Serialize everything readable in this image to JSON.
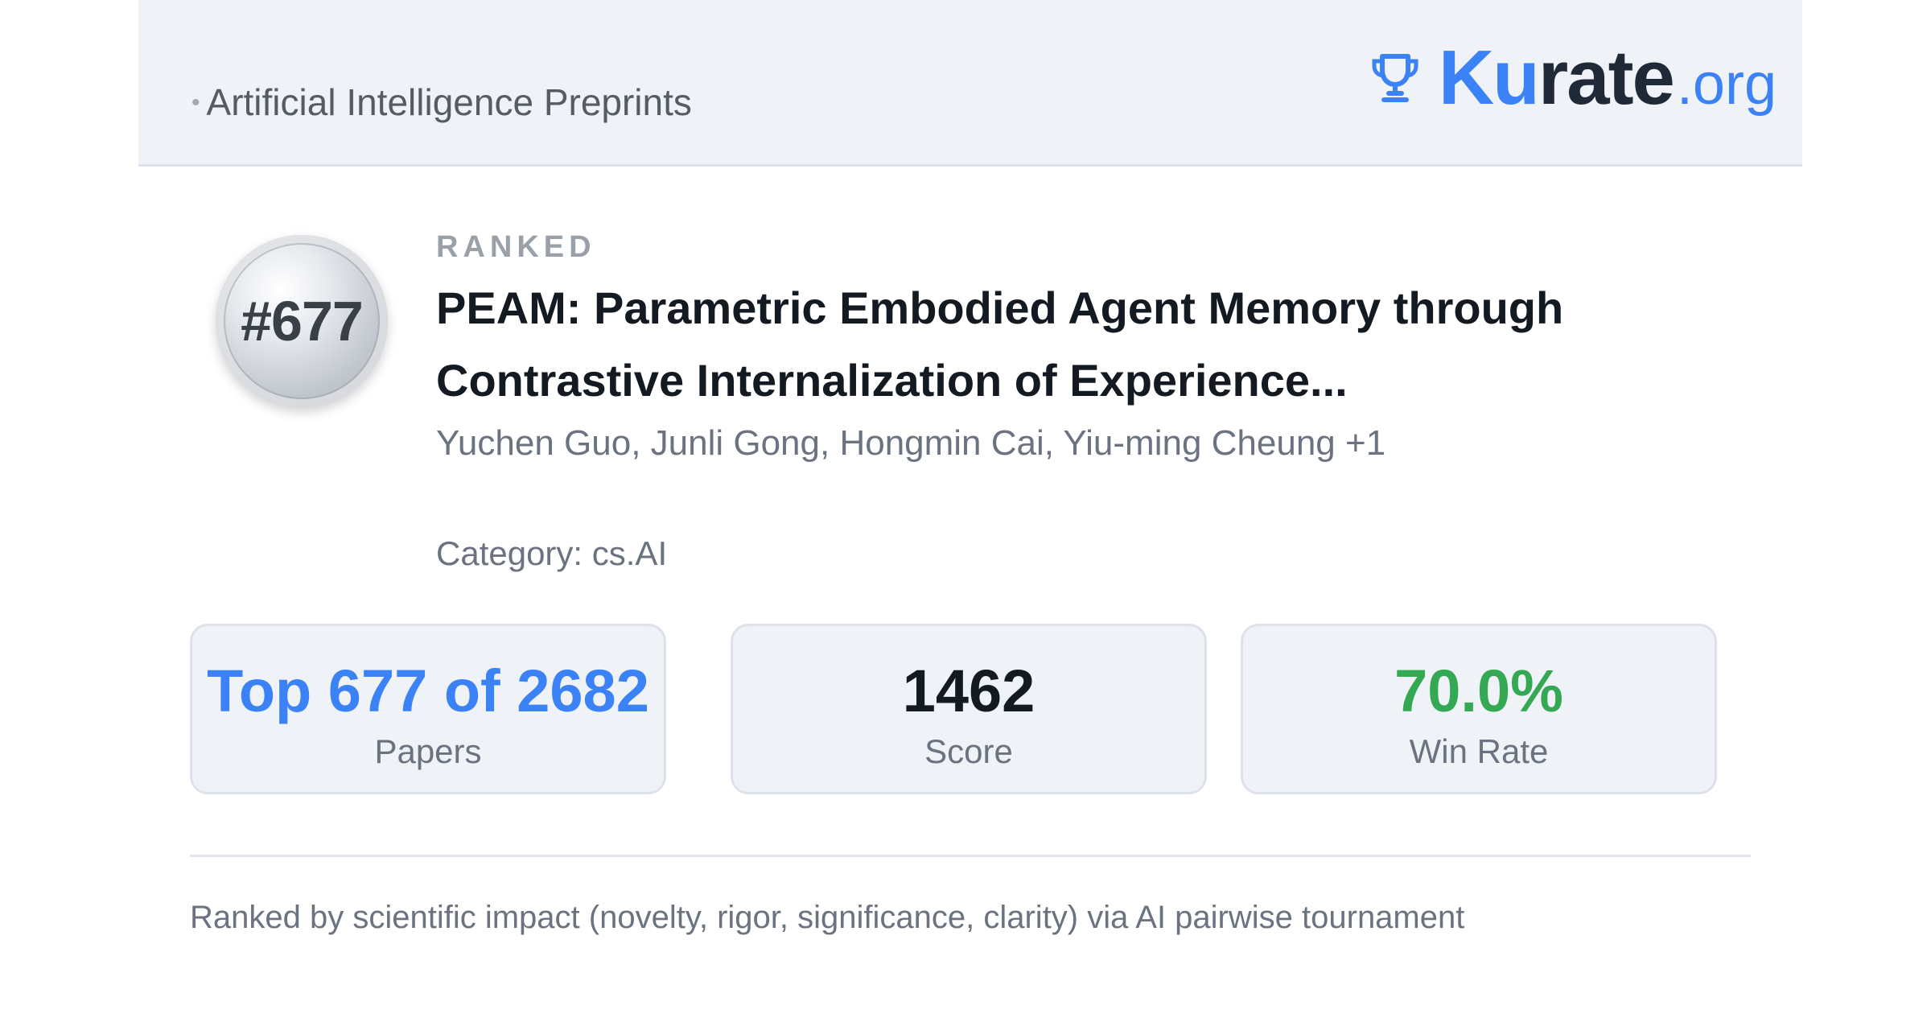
{
  "header": {
    "breadcrumb": "Artificial Intelligence Preprints",
    "brand": {
      "ku": "Ku",
      "rate": "rate",
      "org": ".org",
      "icon": "trophy-icon"
    }
  },
  "paper": {
    "rank_badge": "#677",
    "ranked_label": "RANKED",
    "title": "PEAM: Parametric Embodied Agent Memory through Contrastive Internalization of Experience...",
    "authors": "Yuchen Guo, Junli Gong, Hongmin Cai, Yiu-ming Cheung +1",
    "category": "Category: cs.AI"
  },
  "stats": {
    "papers": {
      "value": "Top 677 of 2682",
      "label": "Papers",
      "color": "#3b82f6"
    },
    "score": {
      "value": "1462",
      "label": "Score",
      "color": "#141a22"
    },
    "win_rate": {
      "value": "70.0%",
      "label": "Win Rate",
      "color": "#34a853"
    }
  },
  "footer": {
    "note": "Ranked by scientific impact (novelty, rigor, significance, clarity) via AI pairwise tournament"
  },
  "colors": {
    "accent": "#3b82f6",
    "success": "#34a853",
    "header_bg": "#eff2f7"
  }
}
